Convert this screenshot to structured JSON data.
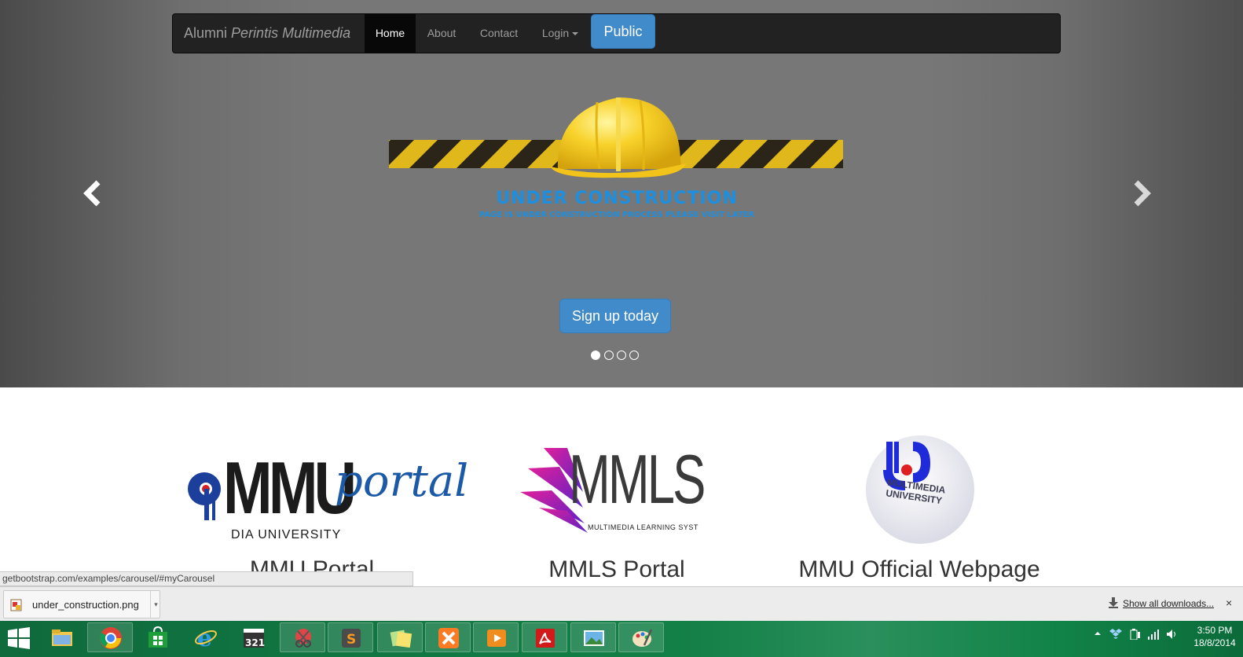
{
  "navbar": {
    "brand_prefix": "Alumni",
    "brand_italic": "Perintis Multimedia",
    "items": [
      "Home",
      "About",
      "Contact",
      "Login"
    ],
    "public_button": "Public"
  },
  "carousel": {
    "construction_title": "UNDER CONSTRUCTION",
    "construction_subtitle": "PAGE IS UNDER CONSTRUCTION PROCESS PLEASE VISIT LATER",
    "signup_button": "Sign up today",
    "slide_count": 4,
    "active_slide": 1
  },
  "marketing": [
    {
      "logo_text": "MMU",
      "logo_script": "portal",
      "logo_sub": "DIA UNIVERSITY",
      "caption": "MMU Portal"
    },
    {
      "logo_text": "MMLS",
      "logo_sub": "MULTIMEDIA LEARNING SYST",
      "caption": "MMLS Portal"
    },
    {
      "logo_text": "MULTIMEDIA UNIVERSITY",
      "caption": "MMU Official Webpage"
    }
  ],
  "status_bar": {
    "url": "getbootstrap.com/examples/carousel/#myCarousel"
  },
  "download_shelf": {
    "file_name": "under_construction.png",
    "show_all": "Show all downloads...",
    "close": "×"
  },
  "taskbar": {
    "apps": [
      "windows-start-icon",
      "file-explorer-icon",
      "chrome-icon",
      "store-icon",
      "internet-explorer-icon",
      "media-player-classic-icon",
      "snipping-tool-icon",
      "sublime-text-icon",
      "sticky-notes-icon",
      "xampp-icon",
      "media-player-icon",
      "adobe-reader-icon",
      "photos-icon",
      "paint-icon"
    ],
    "time": "3:50 PM",
    "date": "18/8/2014"
  },
  "colors": {
    "primary": "#428bca",
    "navbar": "#222222",
    "accent_text": "#1d8fe0",
    "taskbar": "#138047"
  }
}
